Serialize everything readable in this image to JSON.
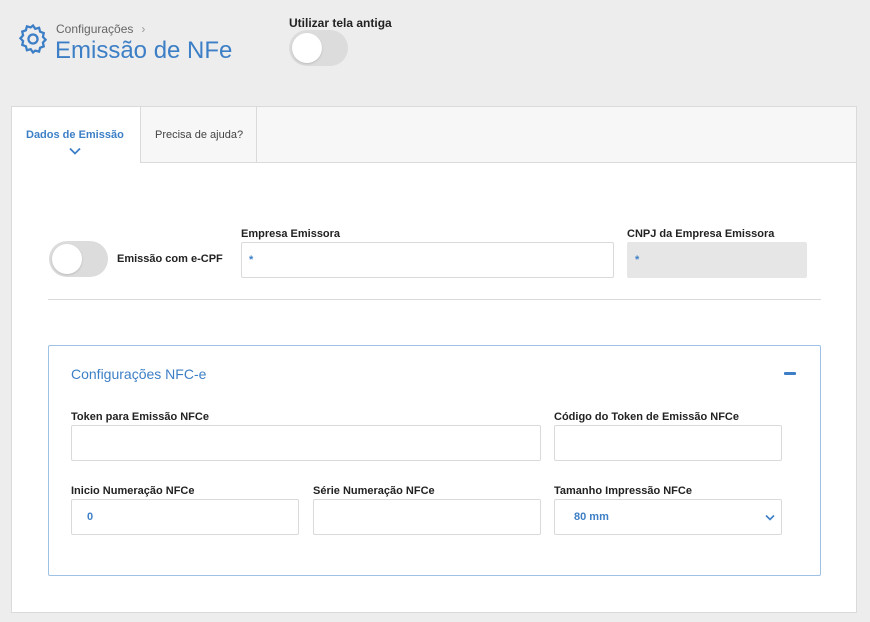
{
  "header": {
    "breadcrumb": "Configurações",
    "breadcrumb_sep": "›",
    "title": "Emissão de NFe",
    "old_screen_label": "Utilizar tela antiga",
    "old_screen_on": false
  },
  "tabs": [
    {
      "label": "Dados de Emissão",
      "active": true
    },
    {
      "label": "Precisa de ajuda?",
      "active": false
    }
  ],
  "emission": {
    "ecpf_label": "Emissão com e-CPF",
    "ecpf_on": false,
    "company_label": "Empresa Emissora",
    "company_value": "*",
    "cnpj_label": "CNPJ da Empresa Emissora",
    "cnpj_value": "*"
  },
  "nfce": {
    "title": "Configurações NFC-e",
    "token_label": "Token para Emissão NFCe",
    "token_value": "",
    "token_code_label": "Código do Token de Emissão NFCe",
    "token_code_value": "",
    "start_num_label": "Inicio Numeração NFCe",
    "start_num_value": "0",
    "series_label": "Série Numeração NFCe",
    "series_value": "",
    "print_size_label": "Tamanho Impressão NFCe",
    "print_size_value": "80 mm"
  },
  "colors": {
    "accent": "#3d7fc6",
    "background": "#ededed",
    "border": "#dadada"
  }
}
